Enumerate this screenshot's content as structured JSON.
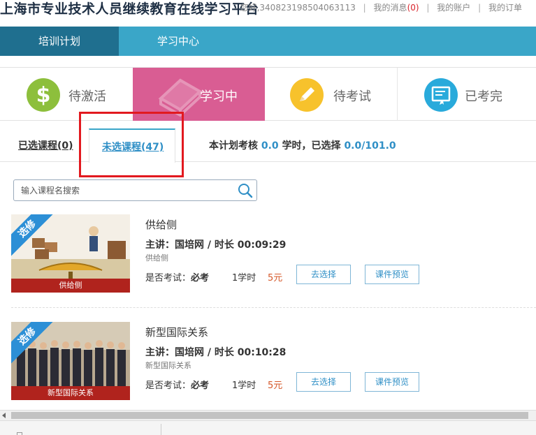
{
  "header": {
    "site_title": "上海市专业技术人员继续教育在线学习平台",
    "greeting": "您好,340823198504063113",
    "messages_label": "我的消息",
    "messages_count": "(0)",
    "account_label": "我的账户",
    "orders_label": "我的订单",
    "separator": "|"
  },
  "nav": {
    "tabs": [
      {
        "label": "培训计划"
      },
      {
        "label": "学习中心"
      }
    ]
  },
  "status_tabs": [
    {
      "label": "待激活",
      "icon": "dollar-icon"
    },
    {
      "label": "学习中",
      "icon": "book-icon"
    },
    {
      "label": "待考试",
      "icon": "pencil-icon"
    },
    {
      "label": "已考完",
      "icon": "certificate-icon"
    }
  ],
  "course_tabs": {
    "selected": "已选课程(0)",
    "unselected": "未选课程(47)",
    "summary_prefix": "本计划考核",
    "required_hours": "0.0",
    "summary_mid": "学时，已选择",
    "selected_hours": "0.0/101.0"
  },
  "search": {
    "placeholder": "输入课程名搜索"
  },
  "courses": [
    {
      "title": "供给侧",
      "meta": "主讲：国培网 / 时长 00:09:29",
      "subtitle": "供给侧",
      "ribbon": "选修",
      "thumb_caption": "供给侧",
      "exam_label": "是否考试：",
      "exam_value": "必考",
      "hours": "1学时",
      "price": "5元",
      "select_button": "去选择",
      "preview_button": "课件预览"
    },
    {
      "title": "新型国际关系",
      "meta": "主讲：国培网 / 时长 00:10:28",
      "subtitle": "新型国际关系",
      "ribbon": "选修",
      "thumb_caption": "新型国际关系",
      "exam_label": "是否考试：",
      "exam_value": "必考",
      "hours": "1学时",
      "price": "5元",
      "select_button": "去选择",
      "preview_button": "课件预览"
    }
  ],
  "colors": {
    "nav_bg": "#3aa6c8",
    "nav_active": "#1f6f8f",
    "studying_tab": "#d95d93",
    "accent_blue": "#2f8fc6",
    "price_orange": "#d5582a",
    "highlight_box": "#e2191f"
  }
}
